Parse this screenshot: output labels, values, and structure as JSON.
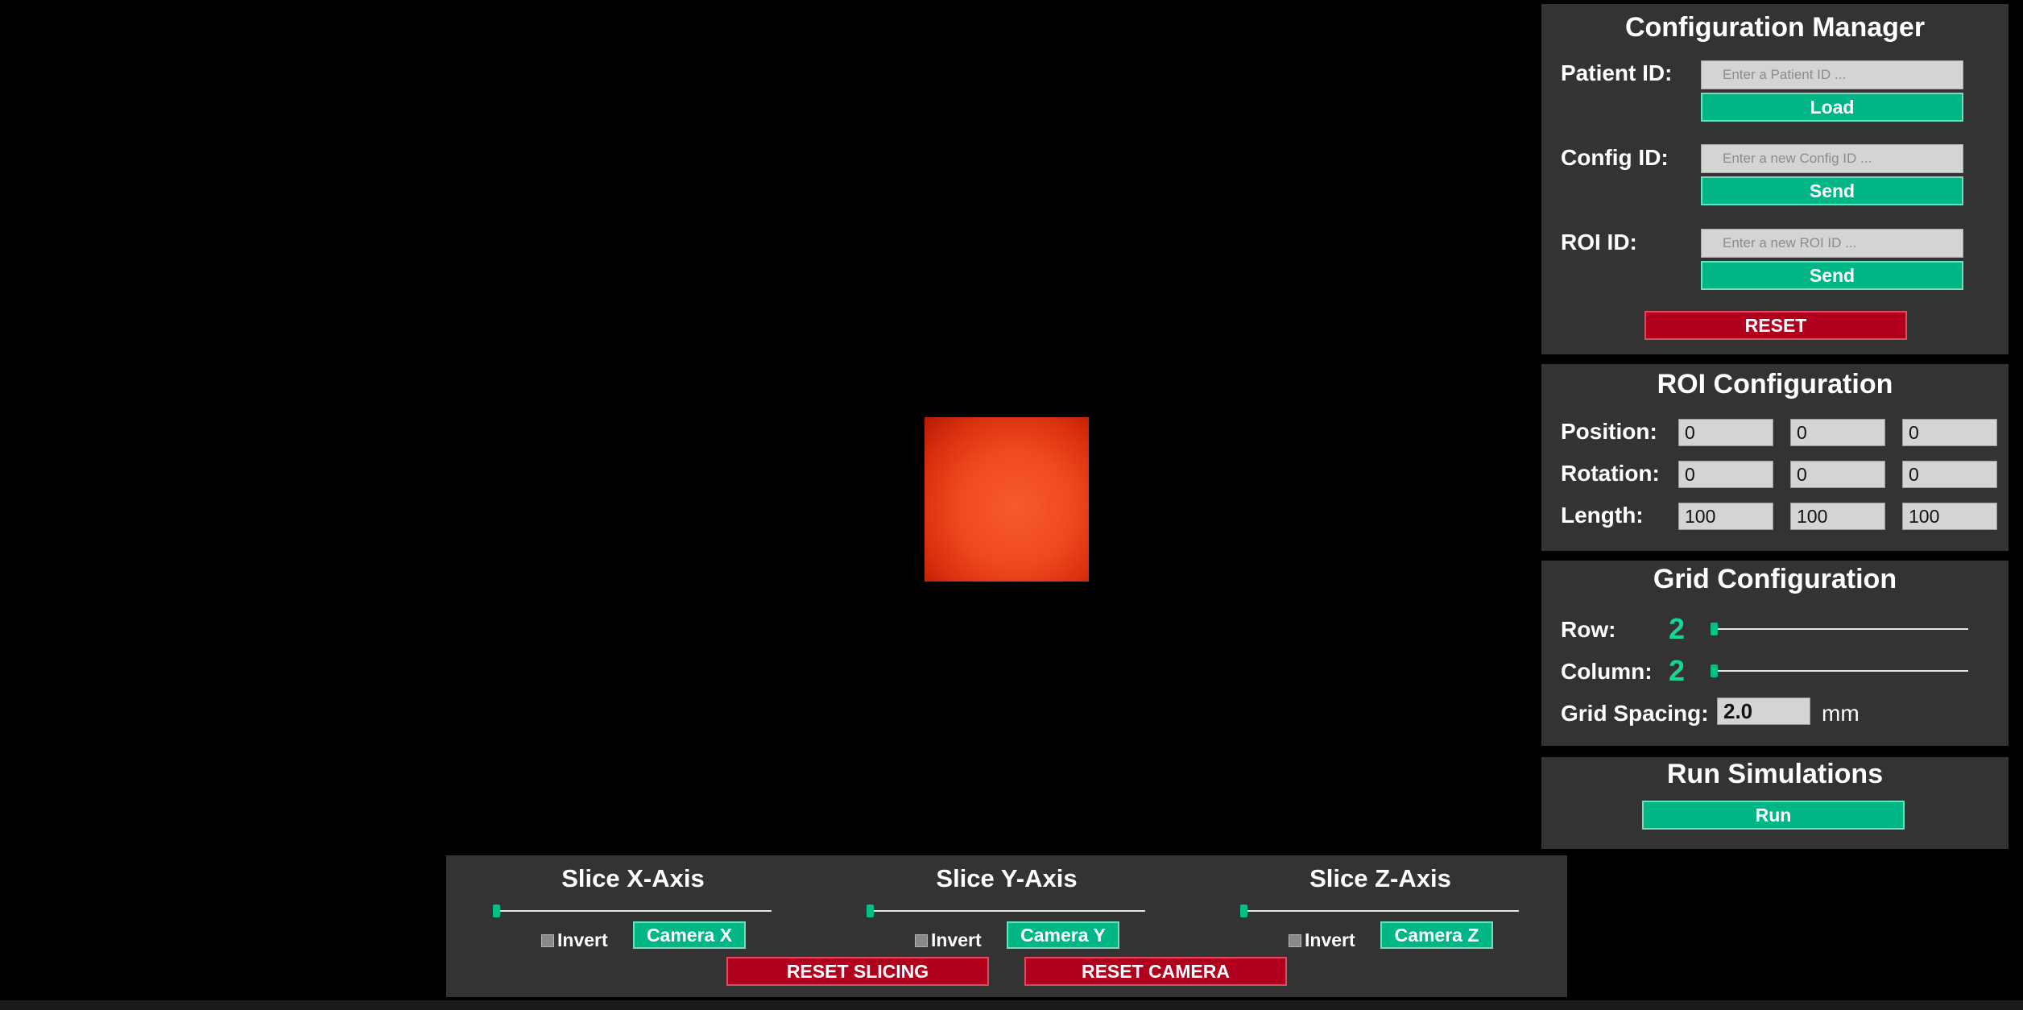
{
  "config_manager": {
    "title": "Configuration Manager",
    "patient_label": "Patient ID:",
    "patient_placeholder": "Enter a Patient ID ...",
    "load_label": "Load",
    "config_label": "Config ID:",
    "config_placeholder": "Enter a new Config ID ...",
    "config_send_label": "Send",
    "roi_label": "ROI ID:",
    "roi_placeholder": "Enter a new ROI ID ...",
    "roi_send_label": "Send",
    "reset_label": "RESET"
  },
  "roi_config": {
    "title": "ROI Configuration",
    "position_label": "Position:",
    "position": [
      "0",
      "0",
      "0"
    ],
    "rotation_label": "Rotation:",
    "rotation": [
      "0",
      "0",
      "0"
    ],
    "length_label": "Length:",
    "length": [
      "100",
      "100",
      "100"
    ]
  },
  "grid_config": {
    "title": "Grid Configuration",
    "row_label": "Row:",
    "row_value": "2",
    "column_label": "Column:",
    "column_value": "2",
    "spacing_label": "Grid Spacing:",
    "spacing_value": "2.0",
    "spacing_unit": "mm"
  },
  "run_sim": {
    "title": "Run Simulations",
    "run_label": "Run"
  },
  "slicing": {
    "x": {
      "title": "Slice X-Axis",
      "invert_label": "Invert",
      "camera_label": "Camera X"
    },
    "y": {
      "title": "Slice Y-Axis",
      "invert_label": "Invert",
      "camera_label": "Camera Y"
    },
    "z": {
      "title": "Slice Z-Axis",
      "invert_label": "Invert",
      "camera_label": "Camera Z"
    },
    "reset_slicing_label": "RESET SLICING",
    "reset_camera_label": "RESET CAMERA"
  },
  "colors": {
    "accent": "#00b586",
    "danger": "#b0001e",
    "panel": "#333333",
    "counter": "#13d69a",
    "roi_box": "#ef4a1e"
  }
}
